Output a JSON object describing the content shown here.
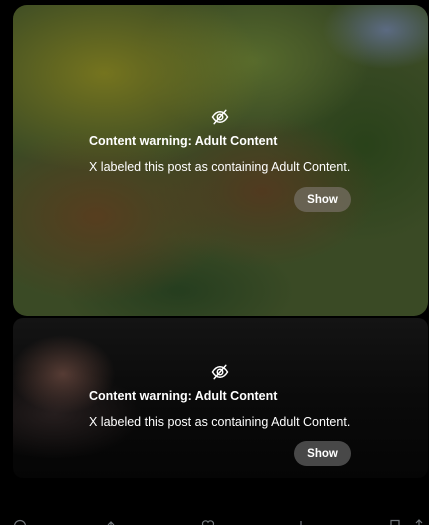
{
  "posts": [
    {
      "warning_title": "Content warning: Adult Content",
      "warning_description": "X labeled this post as containing Adult Content.",
      "show_label": "Show",
      "icon": "eye-slash-icon"
    },
    {
      "warning_title": "Content warning: Adult Content",
      "warning_description": "X labeled this post as containing Adult Content.",
      "show_label": "Show",
      "icon": "eye-slash-icon"
    }
  ],
  "action_bar": {
    "icons": [
      "reply-icon",
      "repost-icon",
      "like-icon",
      "views-icon",
      "bookmark-icon",
      "share-icon"
    ]
  },
  "colors": {
    "background": "#000000",
    "text": "#ffffff"
  }
}
